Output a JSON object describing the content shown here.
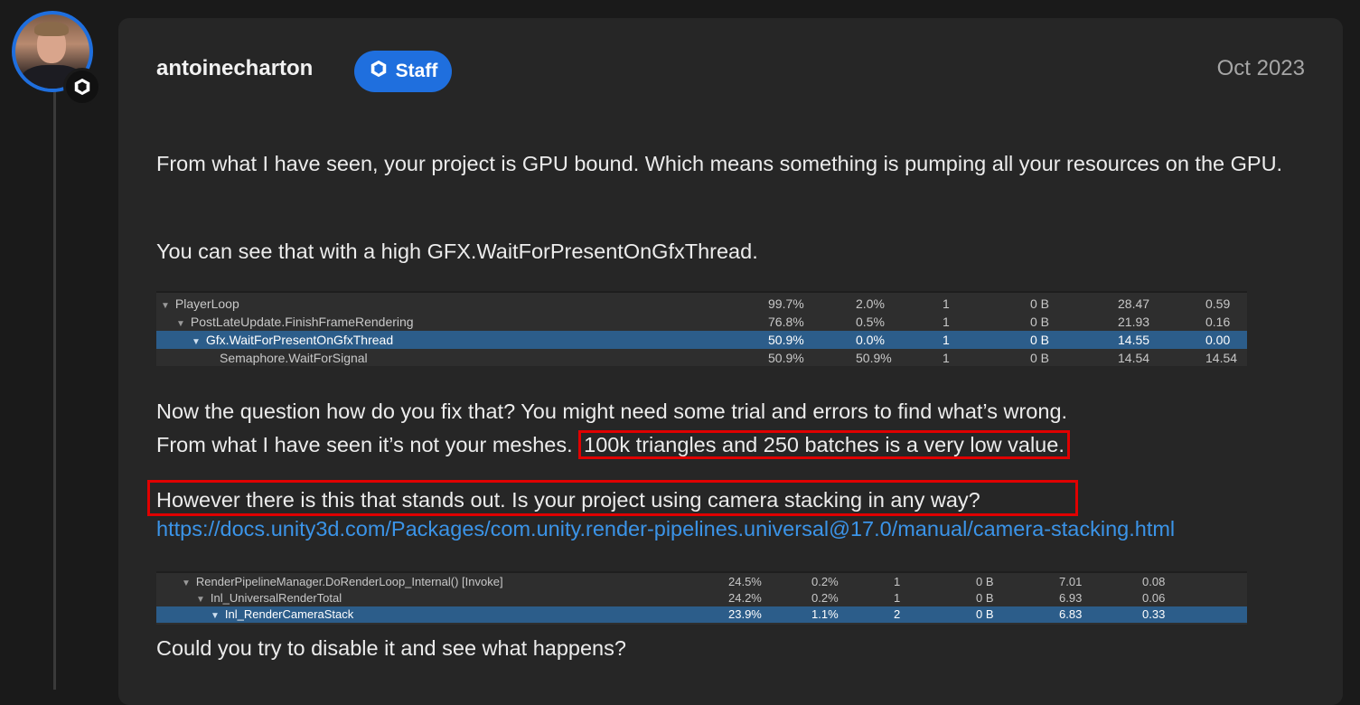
{
  "post": {
    "username": "antoinecharton",
    "badge_label": "Staff",
    "date": "Oct 2023",
    "p1": "From what I have seen, your project is GPU bound. Which means something is pumping all your resources on the GPU.",
    "p2": "You can see that with a high GFX.WaitForPresentOnGfxThread.",
    "p3_line1": "Now the question how do you fix that? You might need some trial and errors to find what’s wrong.",
    "p3_line2_prefix": "From what I have seen it’s not your meshes.",
    "p3_line2_highlight": "100k triangles and 250 batches is a very low value.",
    "p4": "However there is this that stands out. Is your project using camera stacking in any way?",
    "link": "https://docs.unity3d.com/Packages/com.unity.render-pipelines.universal@17.0/manual/camera-stacking.html",
    "p5": "Could you try to disable it and see what happens?"
  },
  "profiler1": {
    "rows": [
      {
        "name": "PlayerLoop",
        "total": "99.7%",
        "self": "2.0%",
        "calls": "1",
        "gc": "0 B",
        "time": "28.47",
        "self_ms": "0.59"
      },
      {
        "name": "PostLateUpdate.FinishFrameRendering",
        "total": "76.8%",
        "self": "0.5%",
        "calls": "1",
        "gc": "0 B",
        "time": "21.93",
        "self_ms": "0.16"
      },
      {
        "name": "Gfx.WaitForPresentOnGfxThread",
        "total": "50.9%",
        "self": "0.0%",
        "calls": "1",
        "gc": "0 B",
        "time": "14.55",
        "self_ms": "0.00"
      },
      {
        "name": "Semaphore.WaitForSignal",
        "total": "50.9%",
        "self": "50.9%",
        "calls": "1",
        "gc": "0 B",
        "time": "14.54",
        "self_ms": "14.54"
      }
    ]
  },
  "profiler2": {
    "rows": [
      {
        "name": "RenderPipelineManager.DoRenderLoop_Internal() [Invoke]",
        "total": "24.5%",
        "self": "0.2%",
        "calls": "1",
        "gc": "0 B",
        "time": "7.01",
        "self_ms": "0.08"
      },
      {
        "name": "Inl_UniversalRenderTotal",
        "total": "24.2%",
        "self": "0.2%",
        "calls": "1",
        "gc": "0 B",
        "time": "6.93",
        "self_ms": "0.06"
      },
      {
        "name": "Inl_RenderCameraStack",
        "total": "23.9%",
        "self": "1.1%",
        "calls": "2",
        "gc": "0 B",
        "time": "6.83",
        "self_ms": "0.33"
      }
    ]
  },
  "colors": {
    "accent": "#1f6fde",
    "highlight_border": "#e00000",
    "link": "#3b94e8",
    "selected_row": "#2c5d8a"
  },
  "icons": {
    "avatar_badge": "unity-logo-icon",
    "staff_badge": "unity-logo-icon",
    "tree_toggle": "triangle-down-icon"
  }
}
